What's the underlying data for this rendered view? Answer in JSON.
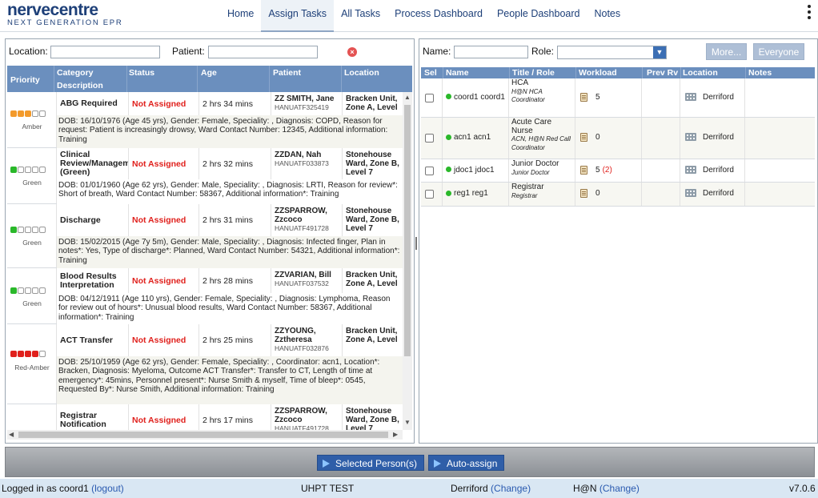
{
  "app": {
    "logo_main": "nervecentre",
    "logo_sub": "NEXT GENERATION EPR"
  },
  "nav": {
    "items": [
      "Home",
      "Assign Tasks",
      "All Tasks",
      "Process Dashboard",
      "People Dashboard",
      "Notes"
    ],
    "active": "Assign Tasks"
  },
  "task_filters": {
    "location_label": "Location:",
    "location_value": "",
    "patient_label": "Patient:",
    "patient_value": ""
  },
  "task_columns": {
    "priority": "Priority",
    "category": "Category",
    "description": "Description",
    "status": "Status",
    "age": "Age",
    "patient": "Patient",
    "location": "Location"
  },
  "tasks": [
    {
      "priority_label": "Amber",
      "dots": [
        "#f39a2b",
        "#f39a2b",
        "#f39a2b",
        "#ffffff",
        "#ffffff"
      ],
      "category": "ABG Required",
      "status": "Not Assigned",
      "age": "2 hrs 34 mins",
      "patient_name": "ZZ SMITH, Jane",
      "patient_id": "HANUATF325419",
      "location": "Bracken Unit, Zone A, Level",
      "description": "DOB: 16/10/1976 (Age 45 yrs), Gender: Female, Speciality: , Diagnosis: COPD, Reason for request: Patient is increasingly drowsy, Ward Contact Number: 12345, Additional information: Training"
    },
    {
      "priority_label": "Green",
      "dots": [
        "#2ab82a",
        "#ffffff",
        "#ffffff",
        "#ffffff",
        "#ffffff"
      ],
      "category": "Clinical Review/Managem (Green)",
      "status": "Not Assigned",
      "age": "2 hrs 32 mins",
      "patient_name": "ZZDAN, Nah",
      "patient_id": "HANUATF033873",
      "location": "Stonehouse Ward, Zone B, Level 7",
      "description": "DOB: 01/01/1960 (Age 62 yrs), Gender: Male, Speciality: , Diagnosis: LRTI, Reason for review*: Short of breath, Ward Contact Number: 58367, Additional information*: Training"
    },
    {
      "priority_label": "Green",
      "dots": [
        "#2ab82a",
        "#ffffff",
        "#ffffff",
        "#ffffff",
        "#ffffff"
      ],
      "category": "Discharge",
      "status": "Not Assigned",
      "age": "2 hrs 31 mins",
      "patient_name": "ZZSPARROW, Zzcoco",
      "patient_id": "HANUATF491728",
      "location": "Stonehouse Ward, Zone B, Level 7",
      "description": "DOB: 15/02/2015 (Age 7y 5m), Gender: Male, Speciality: , Diagnosis: Infected finger, Plan in notes*: Yes, Type of discharge*: Planned, Ward Contact Number: 54321, Additional information*: Training"
    },
    {
      "priority_label": "Green",
      "dots": [
        "#2ab82a",
        "#ffffff",
        "#ffffff",
        "#ffffff",
        "#ffffff"
      ],
      "category": "Blood Results Interpretation",
      "status": "Not Assigned",
      "age": "2 hrs 28 mins",
      "patient_name": "ZZVARIAN, Bill",
      "patient_id": "HANUATF037532",
      "location": "Bracken Unit, Zone A, Level",
      "description": "DOB: 04/12/1911 (Age 110 yrs), Gender: Female, Speciality: , Diagnosis: Lymphoma, Reason for review out of hours*: Unusual blood results, Ward Contact Number: 58367, Additional information*: Training"
    },
    {
      "priority_label": "Red-Amber",
      "dots": [
        "#e0201c",
        "#e0201c",
        "#e0201c",
        "#e0201c",
        "#ffffff"
      ],
      "category": "ACT Transfer",
      "status": "Not Assigned",
      "age": "2 hrs 25 mins",
      "patient_name": "ZZYOUNG, Zztheresa",
      "patient_id": "HANUATF032876",
      "location": "Bracken Unit, Zone A, Level",
      "description": "DOB: 25/10/1959 (Age 62 yrs), Gender: Female, Speciality: , Coordinator: acn1, Location*: Bracken, Diagnosis: Myeloma, Outcome ACT Transfer*: Transfer to CT, Length of time at emergency*: 45mins, Personnel present*: Nurse Smith & myself, Time of bleep*: 0545, Requested By*: Nurse Smith, Additional information: Training"
    },
    {
      "priority_label": "",
      "dots": [],
      "category": "Registrar Notification",
      "status": "Not Assigned",
      "age": "2 hrs 17 mins",
      "patient_name": "ZZSPARROW, Zzcoco",
      "patient_id": "HANUATF491728",
      "location": "Stonehouse Ward, Zone B, Level 7",
      "description": ""
    }
  ],
  "staff_filters": {
    "name_label": "Name:",
    "name_value": "",
    "role_label": "Role:",
    "role_value": "",
    "more_label": "More...",
    "everyone_label": "Everyone"
  },
  "staff_columns": {
    "sel": "Sel",
    "name": "Name",
    "title_role": "Title / Role",
    "workload": "Workload",
    "prev_rv": "Prev Rv",
    "location": "Location",
    "notes": "Notes"
  },
  "staff": [
    {
      "name": "coord1 coord1",
      "title": "HCA",
      "role": "H@N HCA Coordinator",
      "workload": "5",
      "workload_extra": "",
      "location": "Derriford"
    },
    {
      "name": "acn1 acn1",
      "title": "Acute Care Nurse",
      "role": "ACN, H@N Red Call Coordinator",
      "workload": "0",
      "workload_extra": "",
      "location": "Derriford"
    },
    {
      "name": "jdoc1 jdoc1",
      "title": "Junior Doctor",
      "role": "Junior Doctor",
      "workload": "5",
      "workload_extra": "(2)",
      "location": "Derriford"
    },
    {
      "name": "reg1 reg1",
      "title": "Registrar",
      "role": "Registrar",
      "workload": "0",
      "workload_extra": "",
      "location": "Derriford"
    }
  ],
  "actions": {
    "selected_persons": "Selected Person(s)",
    "auto_assign": "Auto-assign"
  },
  "status_bar": {
    "logged_in_text": "Logged in as coord1",
    "logout": "(logout)",
    "system": "UHPT TEST",
    "site": "Derriford",
    "site_change": "(Change)",
    "team": "H@N",
    "team_change": "(Change)",
    "version": "v7.0.6"
  }
}
